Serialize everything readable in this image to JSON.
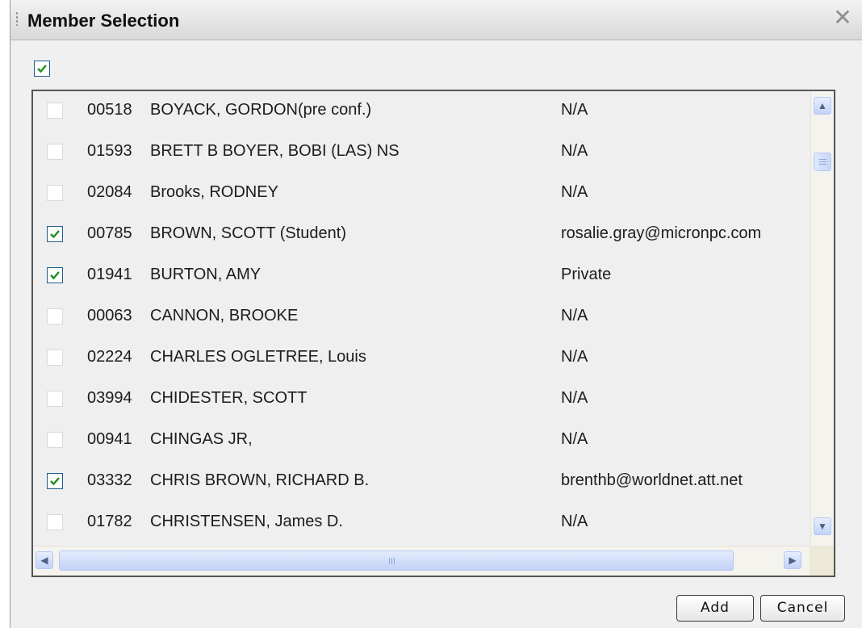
{
  "dialog": {
    "title": "Member Selection",
    "close_symbol": "✕"
  },
  "select_all": {
    "checked": true
  },
  "members": [
    {
      "id": "00518",
      "name": "BOYACK, GORDON(pre conf.)",
      "email": "N/A",
      "checked": false
    },
    {
      "id": "01593",
      "name": "BRETT B BOYER, BOBI (LAS) NS",
      "email": "N/A",
      "checked": false
    },
    {
      "id": "02084",
      "name": "Brooks, RODNEY",
      "email": "N/A",
      "checked": false
    },
    {
      "id": "00785",
      "name": "BROWN, SCOTT (Student)",
      "email": "rosalie.gray@micronpc.com",
      "checked": true
    },
    {
      "id": "01941",
      "name": "BURTON, AMY",
      "email": "Private",
      "checked": true
    },
    {
      "id": "00063",
      "name": "CANNON, BROOKE",
      "email": "N/A",
      "checked": false
    },
    {
      "id": "02224",
      "name": "CHARLES OGLETREE, Louis",
      "email": "N/A",
      "checked": false
    },
    {
      "id": "03994",
      "name": "CHIDESTER, SCOTT",
      "email": "N/A",
      "checked": false
    },
    {
      "id": "00941",
      "name": "CHINGAS JR,",
      "email": "N/A",
      "checked": false
    },
    {
      "id": "03332",
      "name": "CHRIS BROWN, RICHARD B.",
      "email": "brenthb@worldnet.att.net",
      "checked": true
    },
    {
      "id": "01782",
      "name": "CHRISTENSEN, James D.",
      "email": "N/A",
      "checked": false
    }
  ],
  "buttons": {
    "add": "Add",
    "cancel": "Cancel"
  },
  "colors": {
    "check_mark": "#1e8f1e",
    "checkbox_border_checked": "#1f5f8f"
  }
}
